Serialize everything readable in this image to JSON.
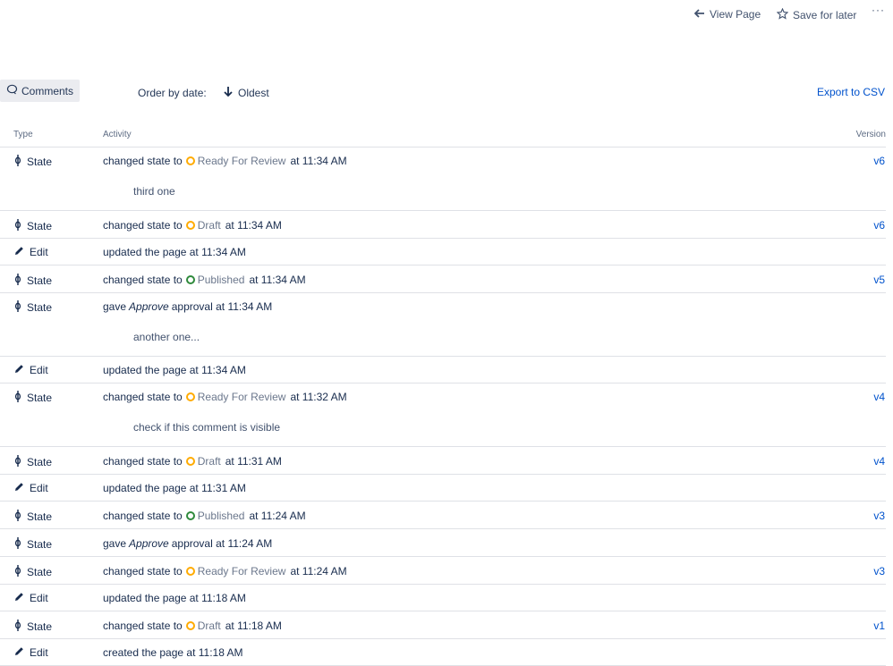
{
  "header": {
    "view_page": "View Page",
    "save_for_later": "Save for later",
    "more": "···"
  },
  "toolbar": {
    "comments": "Comments",
    "order_by": "Order by date:",
    "order_value": "Oldest",
    "export": "Export to CSV"
  },
  "table": {
    "columns": {
      "type": "Type",
      "activity": "Activity",
      "version": "Version"
    },
    "rows": [
      {
        "type": "State",
        "kind": "state",
        "pre": "changed state to",
        "status": "Ready For Review",
        "status_color": "#ffab00",
        "post": "at 11:34 AM",
        "version": "v6",
        "comment": "third one"
      },
      {
        "type": "State",
        "kind": "state",
        "pre": "changed state to",
        "status": "Draft",
        "status_color": "#ffab00",
        "post": "at 11:34 AM",
        "version": "v6",
        "comment": ""
      },
      {
        "type": "Edit",
        "kind": "edit",
        "pre": "updated the page at 11:34 AM",
        "version": "",
        "comment": ""
      },
      {
        "type": "State",
        "kind": "state",
        "pre": "changed state to",
        "status": "Published",
        "status_color": "#2f8a3c",
        "post": "at 11:34 AM",
        "version": "v5",
        "comment": ""
      },
      {
        "type": "State",
        "kind": "approval",
        "pre": "gave",
        "approval": "Approve",
        "post": "approval at 11:34 AM",
        "version": "",
        "comment": "another one..."
      },
      {
        "type": "Edit",
        "kind": "edit",
        "pre": "updated the page at 11:34 AM",
        "version": "",
        "comment": ""
      },
      {
        "type": "State",
        "kind": "state",
        "pre": "changed state to",
        "status": "Ready For Review",
        "status_color": "#ffab00",
        "post": "at 11:32 AM",
        "version": "v4",
        "comment": "check if this comment is visible"
      },
      {
        "type": "State",
        "kind": "state",
        "pre": "changed state to",
        "status": "Draft",
        "status_color": "#ffab00",
        "post": "at 11:31 AM",
        "version": "v4",
        "comment": ""
      },
      {
        "type": "Edit",
        "kind": "edit",
        "pre": "updated the page at 11:31 AM",
        "version": "",
        "comment": ""
      },
      {
        "type": "State",
        "kind": "state",
        "pre": "changed state to",
        "status": "Published",
        "status_color": "#2f8a3c",
        "post": "at 11:24 AM",
        "version": "v3",
        "comment": ""
      },
      {
        "type": "State",
        "kind": "approval",
        "pre": "gave",
        "approval": "Approve",
        "post": "approval at 11:24 AM",
        "version": "",
        "comment": ""
      },
      {
        "type": "State",
        "kind": "state",
        "pre": "changed state to",
        "status": "Ready For Review",
        "status_color": "#ffab00",
        "post": "at 11:24 AM",
        "version": "v3",
        "comment": ""
      },
      {
        "type": "Edit",
        "kind": "edit",
        "pre": "updated the page at 11:18 AM",
        "version": "",
        "comment": ""
      },
      {
        "type": "State",
        "kind": "state",
        "pre": "changed state to",
        "status": "Draft",
        "status_color": "#ffab00",
        "post": "at 11:18 AM",
        "version": "v1",
        "comment": ""
      },
      {
        "type": "Edit",
        "kind": "edit",
        "pre": "created the page at 11:18 AM",
        "version": "",
        "comment": ""
      }
    ]
  },
  "icons": {
    "view_page": "arrow-left-icon",
    "save_for_later": "star-icon",
    "comments": "comment-bubble-icon",
    "order": "arrow-down-icon",
    "state": "state-workflow-icon",
    "edit": "pencil-icon",
    "status": "status-ring-icon"
  },
  "colors": {
    "link": "#0052cc",
    "status_yellow": "#ffab00",
    "status_green": "#2f8a3c",
    "divider": "#dfe1e6"
  }
}
